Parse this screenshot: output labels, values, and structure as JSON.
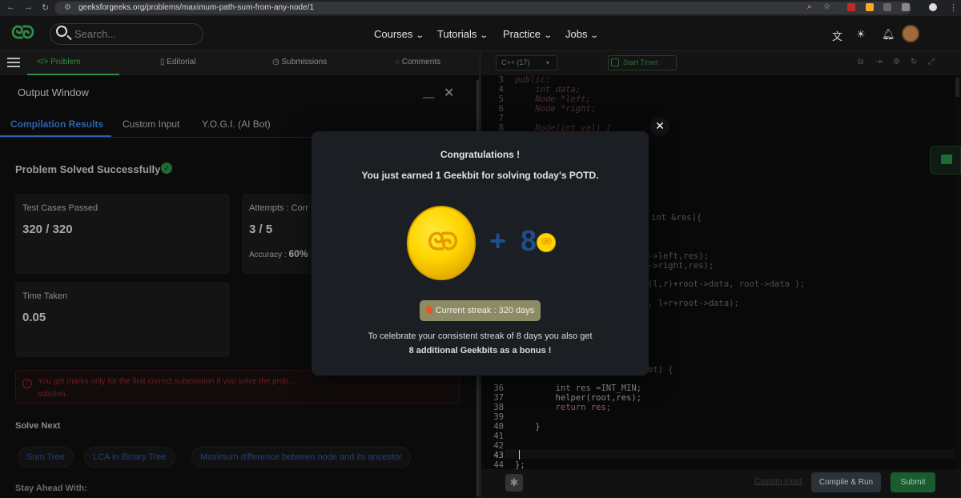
{
  "browser": {
    "url": "geeksforgeeks.org/problems/maximum-path-sum-from-any-node/1"
  },
  "header": {
    "search_placeholder": "Search...",
    "nav": [
      "Courses",
      "Tutorials",
      "Practice",
      "Jobs"
    ]
  },
  "problem_tabs": {
    "problem": "</> Problem",
    "editorial": "Editorial",
    "submissions": "Submissions",
    "comments": "Comments"
  },
  "output_window": {
    "title": "Output Window",
    "minimize": "__",
    "close": "✕",
    "tabs": [
      "Compilation Results",
      "Custom Input",
      "Y.O.G.I. (AI Bot)"
    ],
    "status": "Problem Solved Successfully",
    "test_cases_label": "Test Cases Passed",
    "test_cases_value": "320 / 320",
    "attempts_label": "Attempts : Corr",
    "attempts_value": "3 / 5",
    "accuracy_label": "Accuracy :",
    "accuracy_value": "60%",
    "time_label": "Time Taken",
    "time_value": "0.05",
    "marks_note": "You get marks only for the first correct submission if you solve the prob...",
    "marks_note_2": "solution.",
    "solve_next": "Solve Next",
    "next_problems": [
      "Sum Tree",
      "LCA in Binary Tree",
      "Maximum difference between node and its ancestor"
    ],
    "stay_ahead": "Stay Ahead With:"
  },
  "editor": {
    "language": "C++ (17)",
    "start_timer": "Start Timer",
    "lines": [
      {
        "n": "3",
        "code": "public:"
      },
      {
        "n": "4",
        "code": "    int data;"
      },
      {
        "n": "5",
        "code": "    Node *left;"
      },
      {
        "n": "6",
        "code": "    Node *right;"
      },
      {
        "n": "7",
        "code": ""
      },
      {
        "n": "8",
        "code": "    Node(int val) {"
      }
    ],
    "fragments": [
      "int &res){",
      "->left,res);",
      "->right,res);",
      "(l,r)+root->data, root->data );",
      ", l+r+root->data);",
      "ot) {"
    ],
    "bottom_lines": [
      {
        "n": "36",
        "code": "        int res =INT_MIN;"
      },
      {
        "n": "37",
        "code": "        helper(root,res);"
      },
      {
        "n": "38",
        "code": "        return res;"
      },
      {
        "n": "39",
        "code": ""
      },
      {
        "n": "40",
        "code": "    }"
      },
      {
        "n": "41",
        "code": ""
      },
      {
        "n": "42",
        "code": ""
      },
      {
        "n": "43",
        "code": ""
      },
      {
        "n": "44",
        "code": "};"
      }
    ],
    "custom_input": "Custom Input",
    "compile_run": "Compile & Run",
    "submit": "Submit"
  },
  "modal": {
    "title": "Congratulations !",
    "subtitle": "You just earned 1 Geekbit for solving today's POTD.",
    "reward": "+ 8",
    "streak": "Current streak : 320 days",
    "bonus_line1": "To celebrate your consistent streak of 8 days you also get",
    "bonus_line2": "8 additional Geekbits as a bonus !",
    "close": "✕"
  },
  "colors": {
    "brand_green": "#2f8d46",
    "coin_gold": "#ffd400",
    "accent_blue": "#1d4f8e"
  }
}
